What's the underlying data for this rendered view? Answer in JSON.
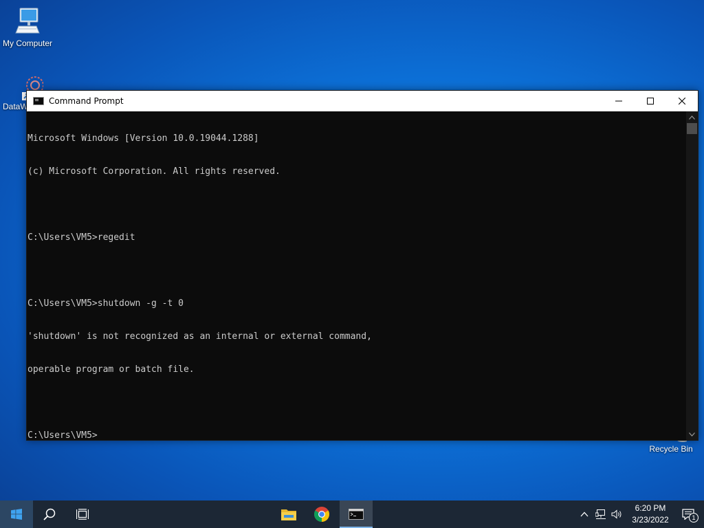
{
  "desktop": {
    "icons": [
      {
        "label": "My Computer",
        "icon": "monitor-icon"
      },
      {
        "label": "DataW",
        "icon": "shortcut-app-icon"
      },
      {
        "label": "Recycle Bin",
        "icon": "recycle-bin-icon"
      }
    ],
    "background_color": "#0c6fd6"
  },
  "window": {
    "title": "Command Prompt",
    "icon": "cmd-icon",
    "controls": [
      "minimize",
      "maximize",
      "close"
    ],
    "background": "#0c0c0c",
    "text_color": "#cccccc",
    "console_lines": [
      "Microsoft Windows [Version 10.0.19044.1288]",
      "(c) Microsoft Corporation. All rights reserved.",
      "",
      "C:\\Users\\VM5>regedit",
      "",
      "C:\\Users\\VM5>shutdown -g -t 0",
      "'shutdown' is not recognized as an internal or external command,",
      "operable program or batch file.",
      "",
      "C:\\Users\\VM5>"
    ]
  },
  "taskbar": {
    "background": "#1c2735",
    "buttons": [
      {
        "name": "start",
        "icon": "windows-logo-icon"
      },
      {
        "name": "search",
        "icon": "search-icon"
      },
      {
        "name": "task-view",
        "icon": "task-view-icon"
      },
      {
        "name": "file-explorer",
        "icon": "folder-icon"
      },
      {
        "name": "chrome",
        "icon": "chrome-icon"
      },
      {
        "name": "command-prompt",
        "icon": "cmd-icon",
        "active": true
      }
    ],
    "tray": {
      "icons": [
        "chevron-up-icon",
        "network-icon",
        "volume-icon"
      ],
      "time": "6:20 PM",
      "date": "3/23/2022",
      "notification_count": "1"
    }
  }
}
